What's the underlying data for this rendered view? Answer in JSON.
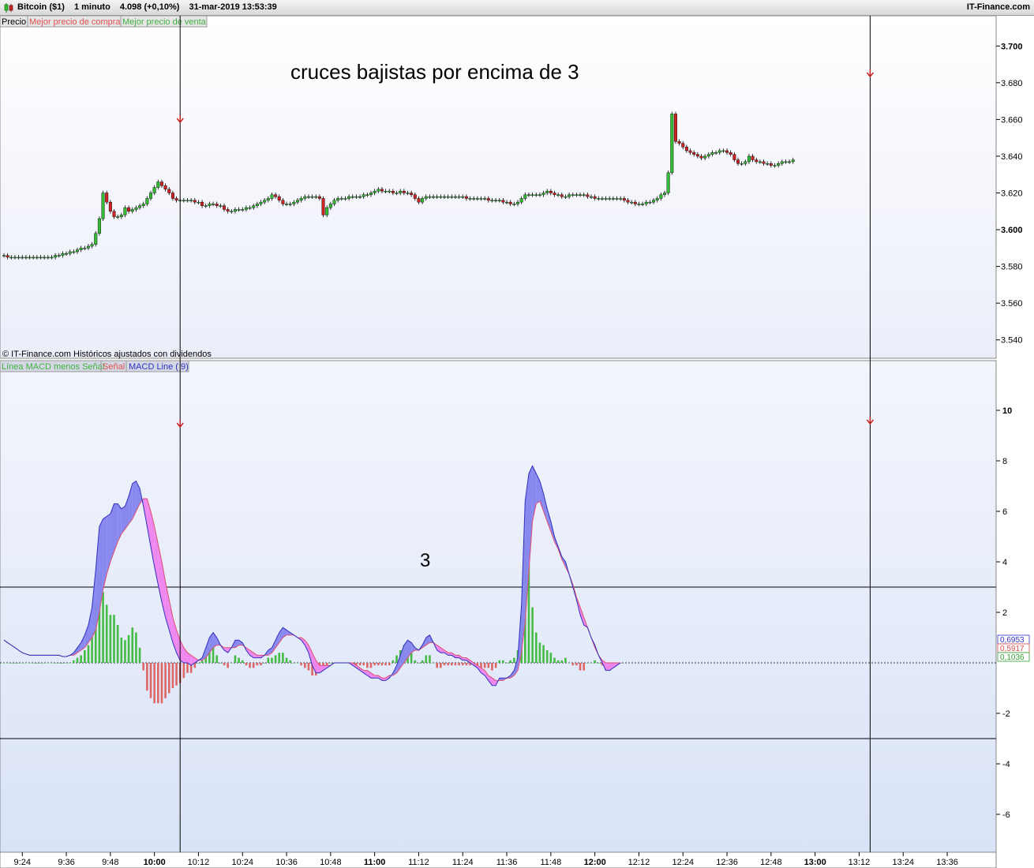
{
  "titlebar": {
    "instrument": "Bitcoin ($1)",
    "interval": "1 minuto",
    "last": "4.098 (+0,10%)",
    "datetime": "31-mar-2019 13:53:39",
    "brand": "IT-Finance.com"
  },
  "price_panel": {
    "legend": [
      "Precio",
      "Mejor precio de compra",
      "Mejor precio de venta"
    ],
    "legend_colors": [
      "#000000",
      "#e05050",
      "#40b040"
    ],
    "annotation": "cruces bajistas por encima de 3",
    "footer": "© IT-Finance.com  Históricos ajustados con dividendos",
    "y_ticks": [
      "3.700",
      "3.680",
      "3.660",
      "3.640",
      "3.620",
      "3.600",
      "3.580",
      "3.560",
      "3.540"
    ]
  },
  "macd_panel": {
    "legend": [
      "Línea MACD menos Señal",
      "Señal",
      "MACD Line ( 9)"
    ],
    "legend_colors": [
      "#40b040",
      "#e05050",
      "#3030c0"
    ],
    "annotation": "3",
    "y_ticks": [
      "10",
      "8",
      "6",
      "4",
      "2",
      "-2",
      "-4",
      "-6"
    ],
    "value_badges": [
      "0,6953",
      "0,5917",
      "0,1036"
    ],
    "badge_colors": [
      "#3030c0",
      "#e05050",
      "#30a030"
    ]
  },
  "x_ticks": [
    "9:24",
    "9:36",
    "9:48",
    "10:00",
    "10:12",
    "10:24",
    "10:36",
    "10:48",
    "11:00",
    "11:12",
    "11:24",
    "11:36",
    "11:48",
    "12:00",
    "12:12",
    "12:24",
    "12:36",
    "12:48",
    "13:00",
    "13:12",
    "13:24",
    "13:36"
  ],
  "x_ticks_bold": [
    "10:00",
    "11:00",
    "12:00",
    "13:00"
  ],
  "colors": {
    "bull": "#33bb33",
    "bear": "#cc2222",
    "macd": "#3030c0",
    "signal": "#e05070",
    "fill_up": "#8888ee",
    "fill_down": "#ee88ee",
    "hist_pos": "#44bb44",
    "hist_neg": "#dd6666"
  },
  "chart_data": [
    {
      "type": "candlestick",
      "title": "Bitcoin ($1) 1 minuto",
      "x_start": "9:19",
      "x_step_minutes": 1,
      "ylim": [
        3530,
        3710
      ],
      "close": [
        3586,
        3585,
        3585,
        3585,
        3585,
        3585,
        3585,
        3585,
        3585,
        3585,
        3585,
        3585,
        3585,
        3585,
        3586,
        3586,
        3587,
        3587,
        3588,
        3588,
        3589,
        3590,
        3590,
        3591,
        3592,
        3598,
        3606,
        3620,
        3615,
        3610,
        3607,
        3607,
        3608,
        3612,
        3610,
        3611,
        3612,
        3613,
        3614,
        3617,
        3620,
        3623,
        3626,
        3624,
        3622,
        3620,
        3617,
        3616,
        3616,
        3616,
        3616,
        3616,
        3615,
        3615,
        3613,
        3613,
        3614,
        3614,
        3613,
        3613,
        3611,
        3610,
        3610,
        3611,
        3611,
        3611,
        3612,
        3612,
        3613,
        3614,
        3615,
        3616,
        3617,
        3619,
        3618,
        3616,
        3614,
        3614,
        3614,
        3615,
        3616,
        3617,
        3618,
        3618,
        3618,
        3618,
        3617,
        3608,
        3612,
        3614,
        3616,
        3617,
        3617,
        3617,
        3618,
        3618,
        3618,
        3618,
        3619,
        3619,
        3620,
        3621,
        3622,
        3621,
        3621,
        3621,
        3620,
        3620,
        3621,
        3620,
        3620,
        3619,
        3617,
        3615,
        3617,
        3618,
        3618,
        3618,
        3618,
        3618,
        3618,
        3618,
        3618,
        3618,
        3618,
        3618,
        3617,
        3617,
        3617,
        3617,
        3617,
        3617,
        3616,
        3616,
        3616,
        3616,
        3615,
        3615,
        3614,
        3614,
        3615,
        3617,
        3619,
        3619,
        3619,
        3619,
        3619,
        3620,
        3621,
        3620,
        3619,
        3619,
        3618,
        3618,
        3619,
        3619,
        3619,
        3619,
        3619,
        3618,
        3618,
        3617,
        3617,
        3617,
        3617,
        3617,
        3617,
        3617,
        3617,
        3616,
        3615,
        3615,
        3614,
        3614,
        3614,
        3615,
        3615,
        3616,
        3617,
        3619,
        3620,
        3631,
        3663,
        3648,
        3647,
        3645,
        3643,
        3642,
        3641,
        3640,
        3639,
        3640,
        3641,
        3642,
        3642,
        3643,
        3643,
        3642,
        3641,
        3638,
        3636,
        3636,
        3637,
        3640,
        3638,
        3637,
        3637,
        3636,
        3636,
        3635,
        3635,
        3636,
        3637,
        3637,
        3637,
        3638
      ]
    },
    {
      "type": "macd",
      "series_names": [
        "Línea MACD menos Señal",
        "Señal",
        "MACD Line ( 9)"
      ],
      "ylim": [
        -7.5,
        11.5
      ],
      "reference_lines": [
        3,
        -3
      ],
      "macd": [
        0.9,
        0.8,
        0.7,
        0.6,
        0.5,
        0.4,
        0.35,
        0.3,
        0.3,
        0.3,
        0.3,
        0.3,
        0.3,
        0.3,
        0.3,
        0.3,
        0.25,
        0.25,
        0.3,
        0.4,
        0.6,
        0.8,
        1.1,
        1.5,
        2.2,
        3.7,
        5.4,
        5.7,
        5.8,
        5.9,
        6.3,
        6.3,
        6.1,
        6.2,
        6.6,
        7.1,
        7.2,
        6.9,
        6.2,
        5.4,
        4.6,
        3.8,
        3.1,
        2.4,
        1.8,
        1.3,
        0.8,
        0.4,
        0.1,
        0.0,
        0.0,
        -0.1,
        0.0,
        0.1,
        0.2,
        0.6,
        1.0,
        1.2,
        1.0,
        0.7,
        0.5,
        0.4,
        0.6,
        0.9,
        0.9,
        0.8,
        0.5,
        0.3,
        0.2,
        0.2,
        0.2,
        0.3,
        0.5,
        0.6,
        0.9,
        1.2,
        1.4,
        1.3,
        1.2,
        1.1,
        1.0,
        0.9,
        0.7,
        0.4,
        -0.1,
        -0.4,
        -0.4,
        -0.3,
        -0.2,
        -0.1,
        0.0,
        0.0,
        0.0,
        0.0,
        0.0,
        -0.1,
        -0.2,
        -0.3,
        -0.4,
        -0.5,
        -0.6,
        -0.6,
        -0.6,
        -0.7,
        -0.7,
        -0.6,
        -0.4,
        -0.1,
        0.3,
        0.7,
        0.9,
        0.8,
        0.6,
        0.5,
        0.7,
        1.0,
        1.1,
        0.8,
        0.5,
        0.4,
        0.4,
        0.3,
        0.3,
        0.2,
        0.2,
        0.1,
        0.1,
        0.0,
        -0.1,
        -0.2,
        -0.4,
        -0.5,
        -0.7,
        -0.9,
        -0.9,
        -0.6,
        -0.6,
        -0.6,
        -0.5,
        -0.3,
        0.2,
        2.3,
        6.4,
        7.5,
        7.8,
        7.5,
        7.2,
        6.7,
        6.1,
        5.6,
        5.0,
        4.6,
        4.2,
        4.0,
        3.5,
        3.0,
        2.5,
        1.9,
        1.5,
        1.4,
        1.0,
        0.7,
        0.3,
        0.0,
        -0.3,
        -0.3,
        -0.2,
        -0.1,
        0.0,
        0.0
      ],
      "signal": [
        0.9,
        0.8,
        0.7,
        0.6,
        0.5,
        0.4,
        0.35,
        0.3,
        0.3,
        0.3,
        0.3,
        0.3,
        0.3,
        0.3,
        0.3,
        0.3,
        0.25,
        0.25,
        0.3,
        0.3,
        0.4,
        0.5,
        0.6,
        0.8,
        1.0,
        1.3,
        2.0,
        2.9,
        3.5,
        4.0,
        4.4,
        4.8,
        5.1,
        5.3,
        5.5,
        5.7,
        6.0,
        6.3,
        6.5,
        6.5,
        6.0,
        5.4,
        4.7,
        4.0,
        3.2,
        2.5,
        1.8,
        1.3,
        0.9,
        0.6,
        0.4,
        0.3,
        0.2,
        0.1,
        0.1,
        0.2,
        0.4,
        0.6,
        0.7,
        0.7,
        0.6,
        0.6,
        0.6,
        0.6,
        0.7,
        0.7,
        0.6,
        0.5,
        0.4,
        0.3,
        0.3,
        0.3,
        0.3,
        0.4,
        0.6,
        0.8,
        1.0,
        1.1,
        1.1,
        1.1,
        1.0,
        1.0,
        0.9,
        0.7,
        0.4,
        0.1,
        -0.1,
        -0.1,
        -0.1,
        -0.1,
        0.0,
        0.0,
        0.0,
        0.0,
        0.0,
        0.0,
        -0.1,
        -0.2,
        -0.3,
        -0.3,
        -0.4,
        -0.5,
        -0.5,
        -0.6,
        -0.6,
        -0.5,
        -0.5,
        -0.4,
        -0.2,
        0.0,
        0.2,
        0.4,
        0.5,
        0.5,
        0.6,
        0.7,
        0.8,
        0.8,
        0.7,
        0.6,
        0.5,
        0.4,
        0.4,
        0.3,
        0.3,
        0.2,
        0.2,
        0.1,
        0.0,
        -0.1,
        -0.2,
        -0.3,
        -0.5,
        -0.6,
        -0.7,
        -0.7,
        -0.7,
        -0.6,
        -0.6,
        -0.5,
        -0.3,
        0.4,
        1.6,
        3.6,
        5.6,
        6.3,
        6.4,
        6.0,
        5.6,
        5.2,
        4.8,
        4.5,
        4.1,
        3.8,
        3.5,
        3.1,
        2.6,
        2.2,
        1.8,
        1.4,
        1.0,
        0.6,
        0.3,
        0.1,
        0.0,
        0.0,
        0.0,
        0.0,
        0.0
      ]
    }
  ]
}
